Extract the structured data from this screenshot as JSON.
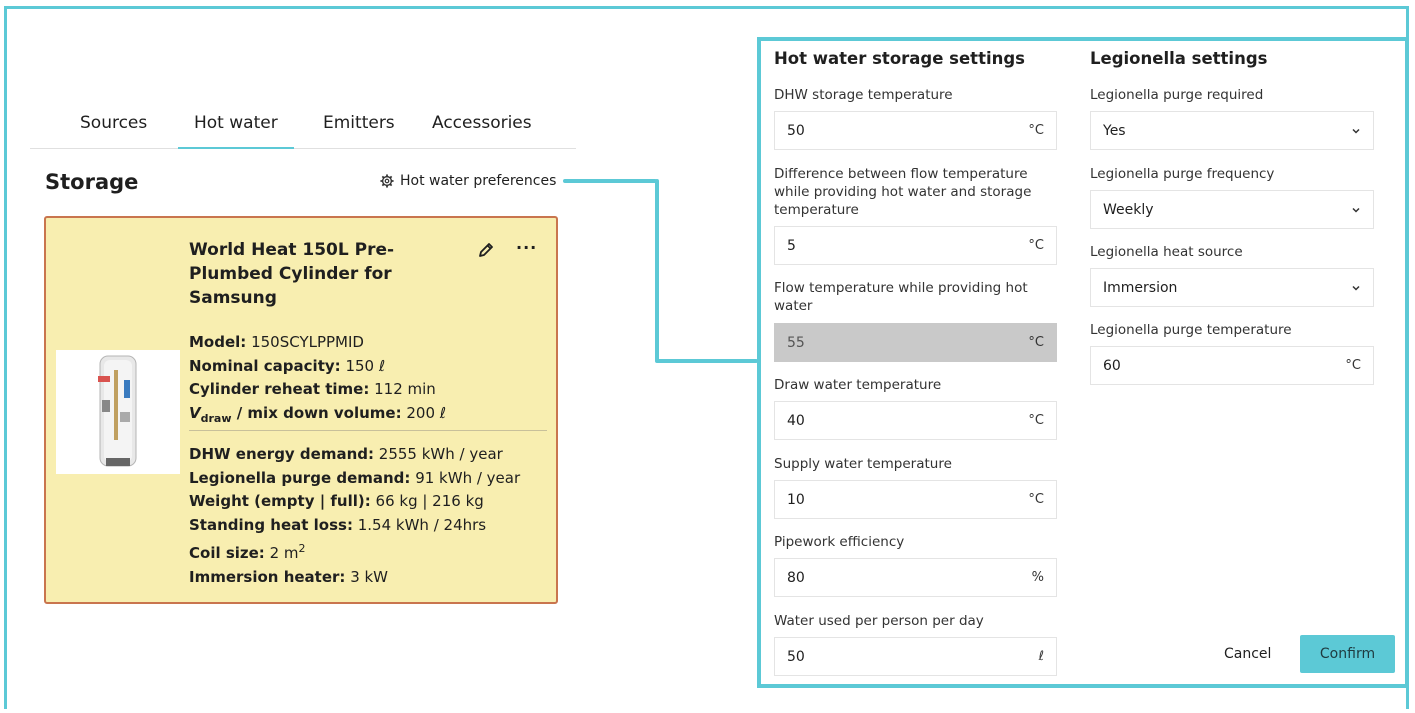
{
  "tabs": [
    {
      "label": "Sources"
    },
    {
      "label": "Hot water"
    },
    {
      "label": "Emitters"
    },
    {
      "label": "Accessories"
    }
  ],
  "storage": {
    "title": "Storage",
    "preferences_link": "Hot water preferences"
  },
  "card": {
    "title": "World Heat 150L Pre-Plumbed Cylinder for Samsung",
    "more_label": "···",
    "specs": [
      {
        "label": "Model:",
        "value": "150SCYLPPMID"
      },
      {
        "label": "Nominal capacity:",
        "value": "150 ℓ"
      },
      {
        "label": "Cylinder reheat time:",
        "value": "112 min"
      },
      {
        "label_v": "V",
        "label_sub": "draw",
        "label_rest": " / mix down volume:",
        "value": "200 ℓ"
      }
    ],
    "specs2": [
      {
        "label": "DHW energy demand:",
        "value": "2555 kWh / year"
      },
      {
        "label": "Legionella purge demand:",
        "value": "91 kWh / year"
      },
      {
        "label": "Weight (empty | full):",
        "value": "66 kg | 216 kg"
      },
      {
        "label": "Standing heat loss:",
        "value": "1.54 kWh / 24hrs"
      },
      {
        "label": "Coil size:",
        "value": "2 m",
        "sup": "2"
      },
      {
        "label": "Immersion heater:",
        "value": "3 kW"
      }
    ]
  },
  "hot_water_settings": {
    "title": "Hot water storage settings",
    "fields": [
      {
        "label": "DHW storage temperature",
        "value": "50",
        "unit": "°C"
      },
      {
        "label": "Difference between flow temperature while providing hot water and storage temperature",
        "value": "5",
        "unit": "°C"
      },
      {
        "label": "Flow temperature while providing hot water",
        "value": "55",
        "unit": "°C"
      },
      {
        "label": "Draw water temperature",
        "value": "40",
        "unit": "°C"
      },
      {
        "label": "Supply water temperature",
        "value": "10",
        "unit": "°C"
      },
      {
        "label": "Pipework efficiency",
        "value": "80",
        "unit": "%"
      },
      {
        "label": "Water used per person per day",
        "value": "50",
        "unit": "ℓ"
      }
    ]
  },
  "legionella_settings": {
    "title": "Legionella settings",
    "fields": [
      {
        "label": "Legionella purge required",
        "value": "Yes"
      },
      {
        "label": "Legionella purge frequency",
        "value": "Weekly"
      },
      {
        "label": "Legionella heat source",
        "value": "Immersion"
      },
      {
        "label": "Legionella purge temperature",
        "value": "60",
        "unit": "°C"
      }
    ]
  },
  "actions": {
    "cancel": "Cancel",
    "confirm": "Confirm"
  },
  "colors": {
    "accent": "#5cc9d6",
    "card_bg": "#f8eeb0",
    "card_border": "#c9754e"
  }
}
